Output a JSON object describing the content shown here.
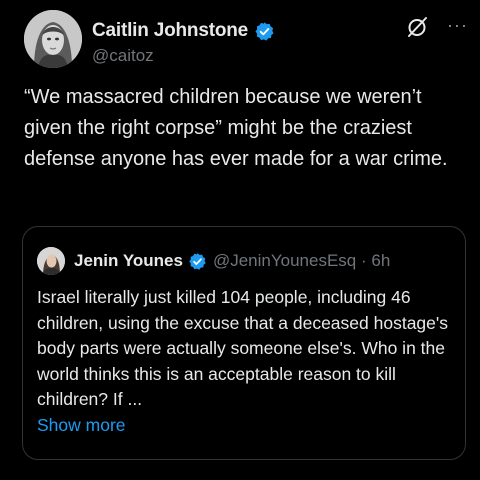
{
  "author": {
    "display_name": "Caitlin Johnstone",
    "handle": "@caitoz",
    "verified_icon": "verified-badge-icon",
    "verified_color": "#1d9bf0"
  },
  "header_icons": {
    "grok": "grok-icon",
    "more": "···"
  },
  "tweet": {
    "text": "“We massacred children because we weren’t given the right corpse” might be the craziest defense anyone has ever made for a war crime."
  },
  "quoted_tweet": {
    "display_name": "Jenin Younes",
    "handle_time": "@JeninYounesEsq · 6h",
    "text": "Israel literally just killed 104 people, including 46 children, using the excuse that a deceased hostage's body parts were actually someone else's.  Who in the world thinks this is an acceptable reason to kill children?  If ...",
    "show_more": "Show more"
  },
  "colors": {
    "background": "#000000",
    "text": "#e7e9ea",
    "secondary": "#71767b",
    "link": "#1d9bf0",
    "border": "#2f3336"
  }
}
